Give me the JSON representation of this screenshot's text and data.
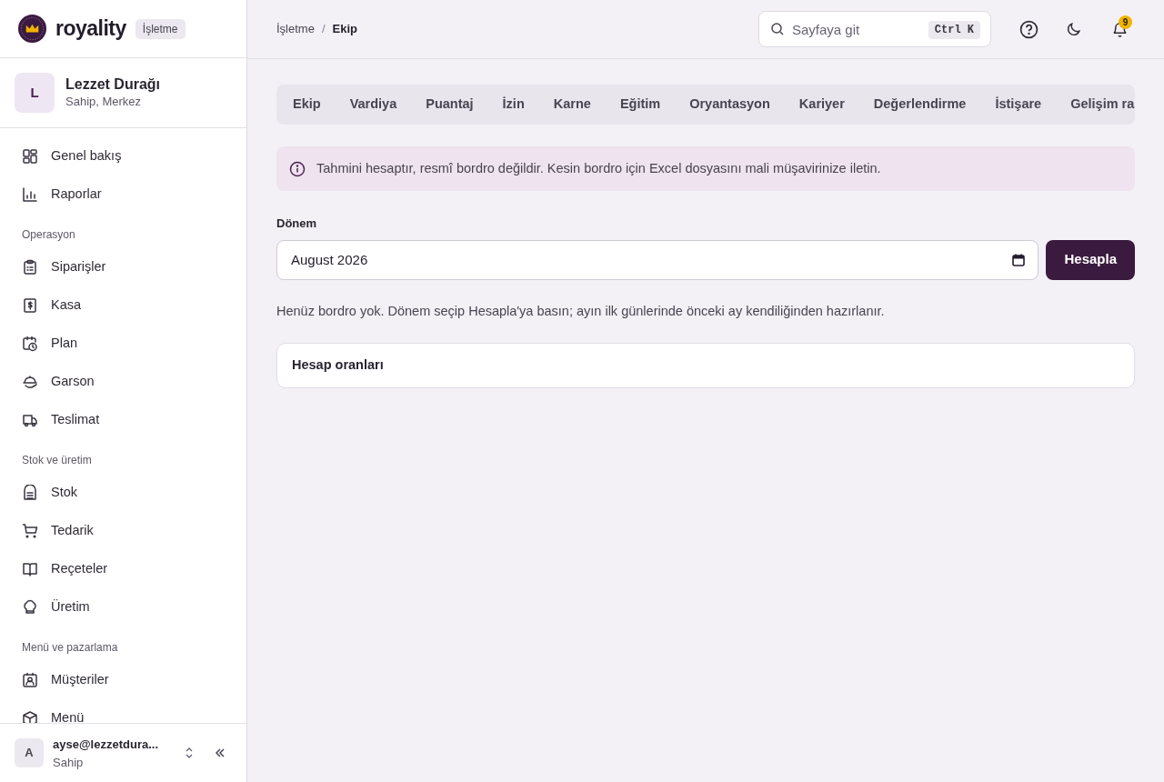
{
  "brand": {
    "name": "royality",
    "badge": "İşletme"
  },
  "business": {
    "avatar": "L",
    "name": "Lezzet Durağı",
    "role": "Sahip, Merkez"
  },
  "sidebar": {
    "sections": [
      {
        "items": [
          {
            "label": "Genel bakış"
          },
          {
            "label": "Raporlar"
          }
        ]
      },
      {
        "title": "Operasyon",
        "items": [
          {
            "label": "Siparişler"
          },
          {
            "label": "Kasa"
          },
          {
            "label": "Plan"
          },
          {
            "label": "Garson"
          },
          {
            "label": "Teslimat"
          }
        ]
      },
      {
        "title": "Stok ve üretim",
        "items": [
          {
            "label": "Stok"
          },
          {
            "label": "Tedarik"
          },
          {
            "label": "Reçeteler"
          },
          {
            "label": "Üretim"
          }
        ]
      },
      {
        "title": "Menü ve pazarlama",
        "items": [
          {
            "label": "Müşteriler"
          },
          {
            "label": "Menü"
          }
        ]
      }
    ]
  },
  "user": {
    "avatar": "A",
    "email": "ayse@lezzetdura...",
    "role": "Sahip"
  },
  "breadcrumb": [
    {
      "label": "İşletme",
      "kind": "link"
    },
    {
      "label": "/",
      "kind": "sep"
    },
    {
      "label": "Ekip",
      "kind": "current"
    }
  ],
  "search": {
    "placeholder": "Sayfaya git",
    "shortcut": "Ctrl K"
  },
  "notifications": {
    "count": "9"
  },
  "tabs": [
    {
      "label": "Ekip",
      "selected": false
    },
    {
      "label": "Vardiya",
      "selected": false
    },
    {
      "label": "Puantaj",
      "selected": false
    },
    {
      "label": "İzin",
      "selected": false
    },
    {
      "label": "Karne",
      "selected": false
    },
    {
      "label": "Eğitim",
      "selected": false
    },
    {
      "label": "Oryantasyon",
      "selected": false
    },
    {
      "label": "Kariyer",
      "selected": false
    },
    {
      "label": "Değerlendirme",
      "selected": false
    },
    {
      "label": "İstişare",
      "selected": false
    },
    {
      "label": "Gelişim ra",
      "selected": false
    }
  ],
  "notice": "Tahmini hesaptır, resmî bordro değildir. Kesin bordro için Excel dosyasını mali müşavirinize iletin.",
  "period": {
    "label": "Dönem",
    "value": "August 2026",
    "button": "Hesapla"
  },
  "empty_message": "Henüz bordro yok. Dönem seçip Hesapla'ya basın; ayın ilk günlerinde önceki ay kendiliğinden hazırlanır.",
  "rates_card": {
    "title": "Hesap oranları"
  }
}
